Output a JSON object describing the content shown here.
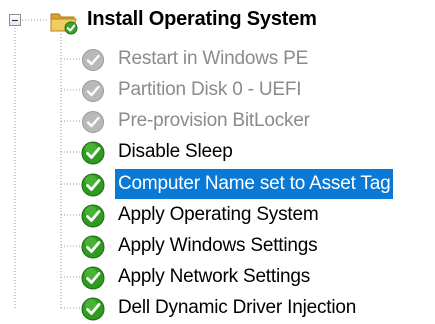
{
  "tree": {
    "root": {
      "label": "Install Operating System",
      "expanded": true,
      "icon": "folder-check-icon"
    },
    "steps": [
      {
        "label": "Restart in Windows PE",
        "state": "disabled",
        "icon": "gray-check-icon"
      },
      {
        "label": "Partition Disk 0 - UEFI",
        "state": "disabled",
        "icon": "gray-check-icon"
      },
      {
        "label": "Pre-provision BitLocker",
        "state": "disabled",
        "icon": "gray-check-icon"
      },
      {
        "label": "Disable Sleep",
        "state": "enabled",
        "icon": "green-check-icon"
      },
      {
        "label": "Computer Name set to Asset Tag",
        "state": "selected",
        "icon": "green-check-icon"
      },
      {
        "label": "Apply Operating System",
        "state": "enabled",
        "icon": "green-check-icon"
      },
      {
        "label": "Apply Windows Settings",
        "state": "enabled",
        "icon": "green-check-icon"
      },
      {
        "label": "Apply Network Settings",
        "state": "enabled",
        "icon": "green-check-icon"
      },
      {
        "label": "Dell Dynamic Driver Injection",
        "state": "enabled",
        "icon": "green-check-icon"
      }
    ],
    "colors": {
      "selection": "#0a79d6",
      "disabled_text": "#8b8b8b",
      "green_check": "#2f9b1f",
      "gray_check": "#a9a9a9",
      "folder": "#e7b94a"
    }
  }
}
